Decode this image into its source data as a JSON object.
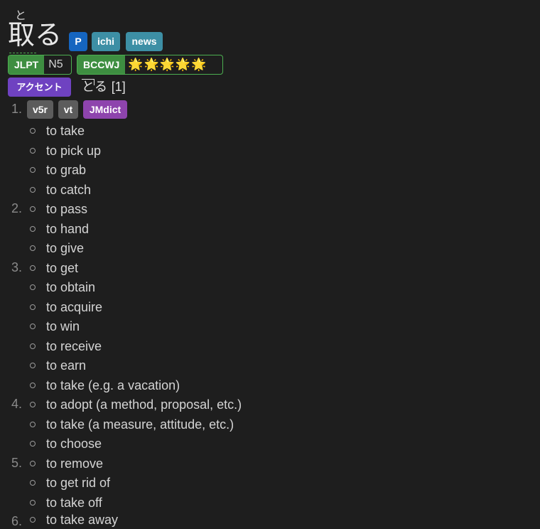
{
  "entry": {
    "reading": "と",
    "kanji": "取る",
    "tags": [
      "P",
      "ichi",
      "news"
    ]
  },
  "jlpt": {
    "label": "JLPT",
    "value": "N5"
  },
  "bccwj": {
    "label": "BCCWJ",
    "stars": 5,
    "stars_text": "🌟🌟🌟🌟🌟"
  },
  "accent": {
    "label": "アクセント",
    "mora_high": "と",
    "mora_low": "る",
    "index": "[1]"
  },
  "senses": {
    "pos_tags": [
      "v5r",
      "vt"
    ],
    "source": "JMdict",
    "numbers": [
      "1.",
      "2.",
      "3.",
      "4.",
      "5.",
      "6."
    ],
    "glosses": [
      "to take",
      "to pick up",
      "to grab",
      "to catch",
      "to pass",
      "to hand",
      "to give",
      "to get",
      "to obtain",
      "to acquire",
      "to win",
      "to receive",
      "to earn",
      "to take (e.g. a vacation)",
      "to adopt (a method, proposal, etc.)",
      "to take (a measure, attitude, etc.)",
      "to choose",
      "to remove",
      "to get rid of",
      "to take off",
      "to take away"
    ]
  },
  "colors": {
    "background": "#1e1e1e",
    "tag_p": "#1565c0",
    "tag_freq": "#3d8fa5",
    "jlpt_green": "#3e8e41",
    "accent_purple": "#6f42c1",
    "jmdict_purple": "#8e44ad",
    "pos_gray": "#5c5c5c"
  }
}
